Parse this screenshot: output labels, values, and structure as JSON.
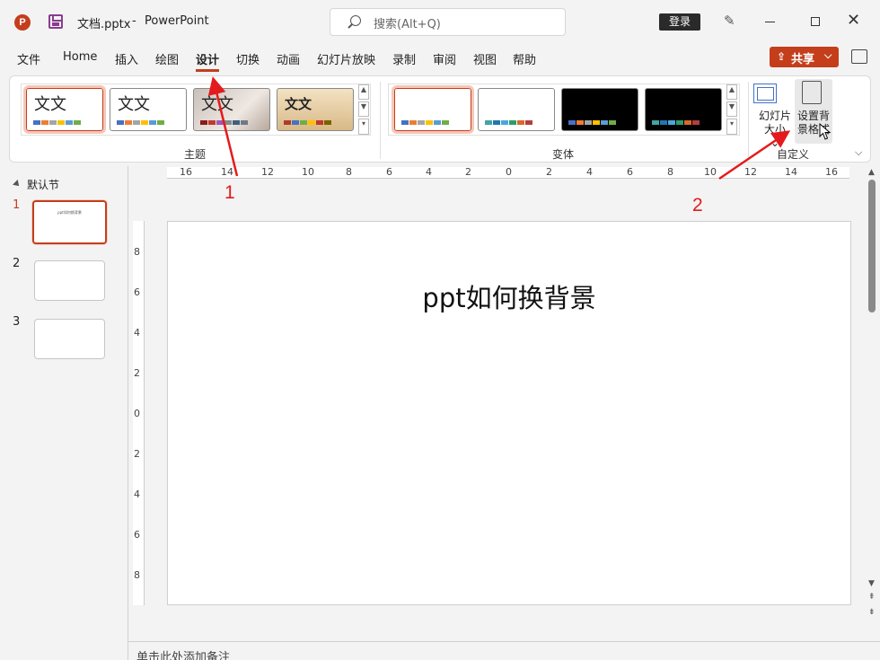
{
  "window": {
    "app_icon_letter": "P",
    "file_name": "文档.pptx",
    "separator": "-",
    "app_name": "PowerPoint",
    "search_placeholder": "搜索(Alt+Q)",
    "login_label": "登录"
  },
  "tabs": [
    {
      "label": "文件"
    },
    {
      "label": "Home"
    },
    {
      "label": "插入"
    },
    {
      "label": "绘图"
    },
    {
      "label": "设计",
      "active": true
    },
    {
      "label": "切换"
    },
    {
      "label": "动画"
    },
    {
      "label": "幻灯片放映"
    },
    {
      "label": "录制"
    },
    {
      "label": "审阅"
    },
    {
      "label": "视图"
    },
    {
      "label": "帮助"
    }
  ],
  "share": {
    "label": "共享",
    "icon": "share-icon",
    "chevron": "⌵"
  },
  "ribbon": {
    "themes_group_label": "主题",
    "variants_group_label": "变体",
    "customize_group_label": "自定义",
    "theme_sample_text": "文文",
    "slide_size_label": [
      "幻灯片",
      "大小 ⌄"
    ],
    "bg_format_label": [
      "设置背",
      "景格式"
    ]
  },
  "colors": {
    "accent": "#c43e1c",
    "swatch_office": [
      "#4472c4",
      "#ed7d31",
      "#a5a5a5",
      "#ffc000",
      "#5b9bd5",
      "#70ad47"
    ],
    "swatch_theme3": [
      "#8b1a1a",
      "#c0392b",
      "#9b59b6",
      "#7f8c8d",
      "#3f5f7f",
      "#6c7a89"
    ],
    "swatch_theme4": [
      "#b03a2e",
      "#4472c4",
      "#70ad47",
      "#ffc000",
      "#c0392b",
      "#7f6000"
    ]
  },
  "slides_panel": {
    "section_label": "默认节",
    "slides": [
      {
        "number": "1",
        "thumb_title": "ppt如何换背景"
      },
      {
        "number": "2",
        "thumb_title": ""
      },
      {
        "number": "3",
        "thumb_title": ""
      }
    ]
  },
  "ruler": {
    "horizontal": [
      "16",
      "14",
      "12",
      "10",
      "8",
      "6",
      "4",
      "2",
      "0",
      "2",
      "4",
      "6",
      "8",
      "10",
      "12",
      "14",
      "16"
    ],
    "vertical": [
      "8",
      "6",
      "4",
      "2",
      "0",
      "2",
      "4",
      "6",
      "8"
    ]
  },
  "slide": {
    "title": "ppt如何换背景"
  },
  "notes": {
    "placeholder": "单击此处添加备注"
  },
  "annotations": {
    "step1": "1",
    "step2": "2"
  }
}
